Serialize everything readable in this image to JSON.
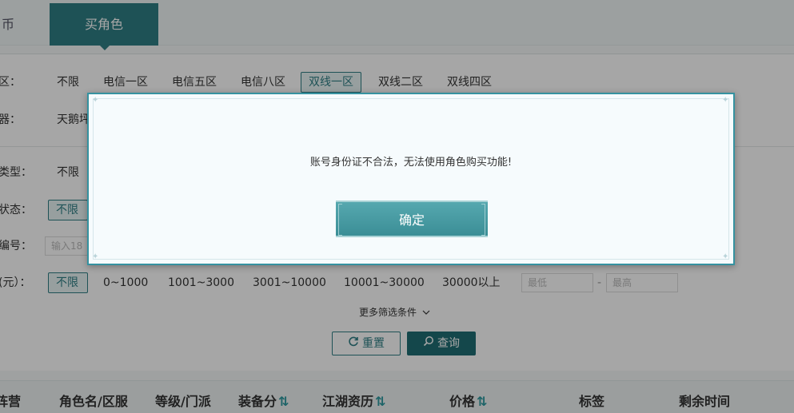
{
  "tabs": [
    {
      "label": "币"
    },
    {
      "label": "买角色"
    }
  ],
  "filters": {
    "server_label": "区：",
    "server_options": [
      "不限",
      "电信一区",
      "电信五区",
      "电信八区",
      "双线一区",
      "双线二区",
      "双线四区"
    ],
    "server_selected": "双线一区",
    "server2_label": "器：",
    "server2_option": "天鹅坪",
    "type_label": "类型：",
    "type_option": "不限",
    "status_label": "状态：",
    "status_option": "不限",
    "id_label": "编号：",
    "id_placeholder": "输入18",
    "price_label": "(元）：",
    "price_options": [
      "不限",
      "0~1000",
      "1001~3000",
      "3001~10000",
      "10001~30000",
      "30000以上"
    ],
    "price_selected": "不限",
    "price_min_placeholder": "最低",
    "price_max_placeholder": "最高",
    "price_dash": "-",
    "more_label": "更多筛选条件",
    "reset_label": "重置",
    "query_label": "查询"
  },
  "table_headers": [
    "阵营",
    "角色名/区服",
    "等级/门派",
    "装备分",
    "江湖资历",
    "价格",
    "标签",
    "剩余时间"
  ],
  "modal": {
    "message": "账号身份证不合法，无法使用角色购买功能!",
    "confirm_label": "确定"
  },
  "icons": {
    "sort": "sort-arrows-icon",
    "chevron": "chevron-down-icon",
    "refresh": "refresh-icon",
    "search": "search-icon"
  },
  "colors": {
    "accent": "#2f7f85",
    "modal_border": "#3592a0",
    "sort_icon": "#2f9aa0"
  }
}
